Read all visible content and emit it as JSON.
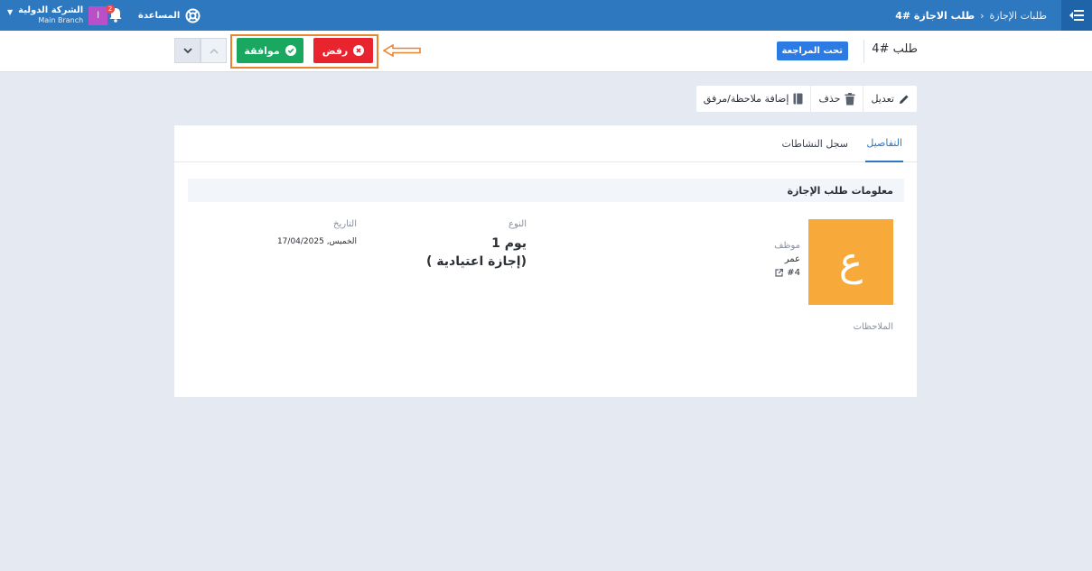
{
  "topbar": {
    "breadcrumb_parent": "طلبات الإجازة",
    "breadcrumb_separator": "›",
    "breadcrumb_current": "طلب الاجازة #4",
    "company_name": "الشركة الدولية",
    "branch_name": "Main Branch",
    "company_initial": "ا",
    "notifications_count": "2",
    "help_label": "المساعدة"
  },
  "actionbar": {
    "request_title": "طلب #4",
    "status": "تحت المراجعة",
    "approve_label": "موافقة",
    "reject_label": "رفض"
  },
  "toolbar": {
    "edit_label": "تعديل",
    "delete_label": "حذف",
    "add_note_label": "إضافة ملاحظة/مرفق"
  },
  "tabs": {
    "details": "التفاصيل",
    "activity_log": "سجل النشاطات"
  },
  "details": {
    "section_title": "معلومات طلب الإجازة",
    "employee": {
      "initial": "ع",
      "label": "موظف",
      "name": "عمر",
      "id": "#4"
    },
    "type": {
      "label": "النوع",
      "days": "1 يوم",
      "kind": "( إجازة اعتيادية)"
    },
    "date": {
      "label": "التاريخ",
      "value": "الخميس, 17/04/2025"
    },
    "notes_label": "الملاحظات"
  },
  "colors": {
    "topbar": "#2e78c0",
    "approve": "#1aa860",
    "reject": "#e8242f",
    "status": "#2c7be5",
    "avatar": "#f7a93a",
    "highlight": "#e9852f"
  }
}
